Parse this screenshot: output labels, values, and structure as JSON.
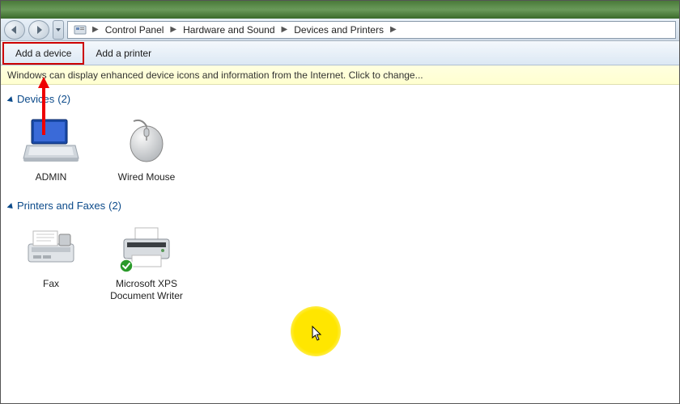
{
  "breadcrumb": {
    "items": [
      "Control Panel",
      "Hardware and Sound",
      "Devices and Printers"
    ]
  },
  "toolbar": {
    "add_device": "Add a device",
    "add_printer": "Add a printer"
  },
  "infobar": {
    "text": "Windows can display enhanced device icons and information from the Internet. Click to change..."
  },
  "groups": [
    {
      "title": "Devices",
      "count": "(2)",
      "items": [
        {
          "name": "ADMIN",
          "icon": "laptop"
        },
        {
          "name": "Wired Mouse",
          "icon": "mouse"
        }
      ]
    },
    {
      "title": "Printers and Faxes",
      "count": "(2)",
      "items": [
        {
          "name": "Fax",
          "icon": "fax"
        },
        {
          "name": "Microsoft XPS Document Writer",
          "icon": "printer",
          "default": true
        }
      ]
    }
  ]
}
